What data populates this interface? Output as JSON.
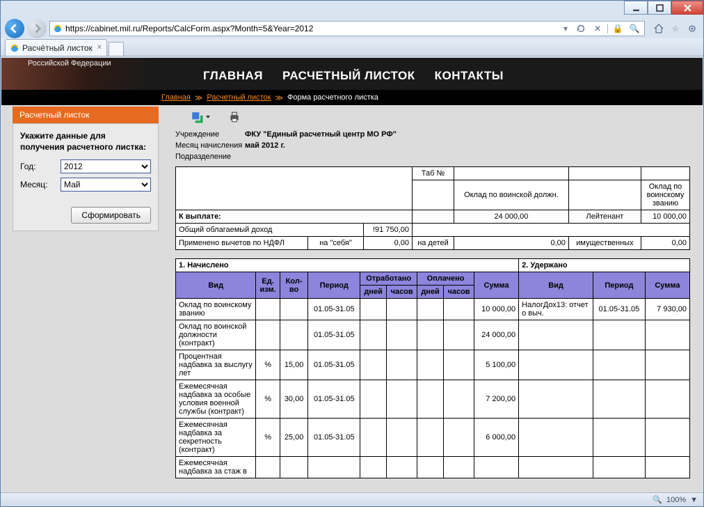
{
  "window": {
    "url": "https://cabinet.mil.ru/Reports/CalcForm.aspx?Month=5&Year=2012",
    "tab_title": "Расчётный листок",
    "zoom": "100%"
  },
  "banner": {
    "subtitle": "Российской Федерации",
    "menu": {
      "home": "ГЛАВНАЯ",
      "payslip": "РАСЧЕТНЫЙ ЛИСТОК",
      "contacts": "КОНТАКТЫ"
    }
  },
  "breadcrumb": {
    "home": "Главная",
    "payslip": "Расчетный листок",
    "current": "Форма расчетного листка"
  },
  "sidebar": {
    "header": "Расчетный листок",
    "prompt": "Укажите данные для получения расчетного листка:",
    "year_label": "Год:",
    "year_value": "2012",
    "month_label": "Месяц:",
    "month_value": "Май",
    "submit": "Сформировать"
  },
  "meta": {
    "inst_k": "Учреждение",
    "inst_v": "ФКУ \"Единый расчетный центр МО РФ\"",
    "month_k": "Месяц начисления",
    "month_v": "май 2012 г.",
    "dept_k": "Подразделение"
  },
  "top_table": {
    "tab_no": "Таб №",
    "col_okl_pos": "Оклад по воинской должн.",
    "col_okl_rank": "Оклад по воинскому званию",
    "to_pay": "К выплате:",
    "pos_val": "24 000,00",
    "rank_lbl": "Лейтенант",
    "rank_val": "10 000,00",
    "row_income": "Общий облагаемый доход",
    "income_val": "!91 750,00",
    "row_ndfl": "Применено вычетов по НДФЛ",
    "ndfl_self": "на \"себя\"",
    "ndfl_self_v": "0,00",
    "ndfl_child": "на детей",
    "ndfl_child_v": "0,00",
    "ndfl_prop": "имущественных",
    "ndfl_prop_v": "0,00"
  },
  "main_table": {
    "h_accrued": "1. Начислено",
    "h_withheld": "2. Удержано",
    "h_vid": "Вид",
    "h_ed": "Ед. изм.",
    "h_qty": "Кол-во",
    "h_period": "Период",
    "h_worked": "Отработано",
    "h_paid": "Оплачено",
    "h_sum": "Сумма",
    "h_days": "дней",
    "h_hours": "часов",
    "rows": [
      {
        "name": "Оклад по воинскому званию",
        "ed": "",
        "qty": "",
        "period": "01.05-31.05",
        "sum": "10 000,00"
      },
      {
        "name": "Оклад по воинской должности (контракт)",
        "ed": "",
        "qty": "",
        "period": "01.05-31.05",
        "sum": "24 000,00"
      },
      {
        "name": "Процентная надбавка за выслугу лет",
        "ed": "%",
        "qty": "15,00",
        "period": "01.05-31.05",
        "sum": "5 100,00"
      },
      {
        "name": "Ежемесячная надбавка за особые условия военной службы (контракт)",
        "ed": "%",
        "qty": "30,00",
        "period": "01.05-31.05",
        "sum": "7 200,00"
      },
      {
        "name": "Ежемесячная надбавка за секретность (контракт)",
        "ed": "%",
        "qty": "25,00",
        "period": "01.05-31.05",
        "sum": "6 000,00"
      },
      {
        "name": "Ежемесячная надбавка за стаж в",
        "ed": "",
        "qty": "",
        "period": "",
        "sum": ""
      }
    ],
    "withheld_rows": [
      {
        "name": "НалогДох13: отчет о выч.",
        "period": "01.05-31.05",
        "sum": "7 930,00"
      }
    ]
  }
}
